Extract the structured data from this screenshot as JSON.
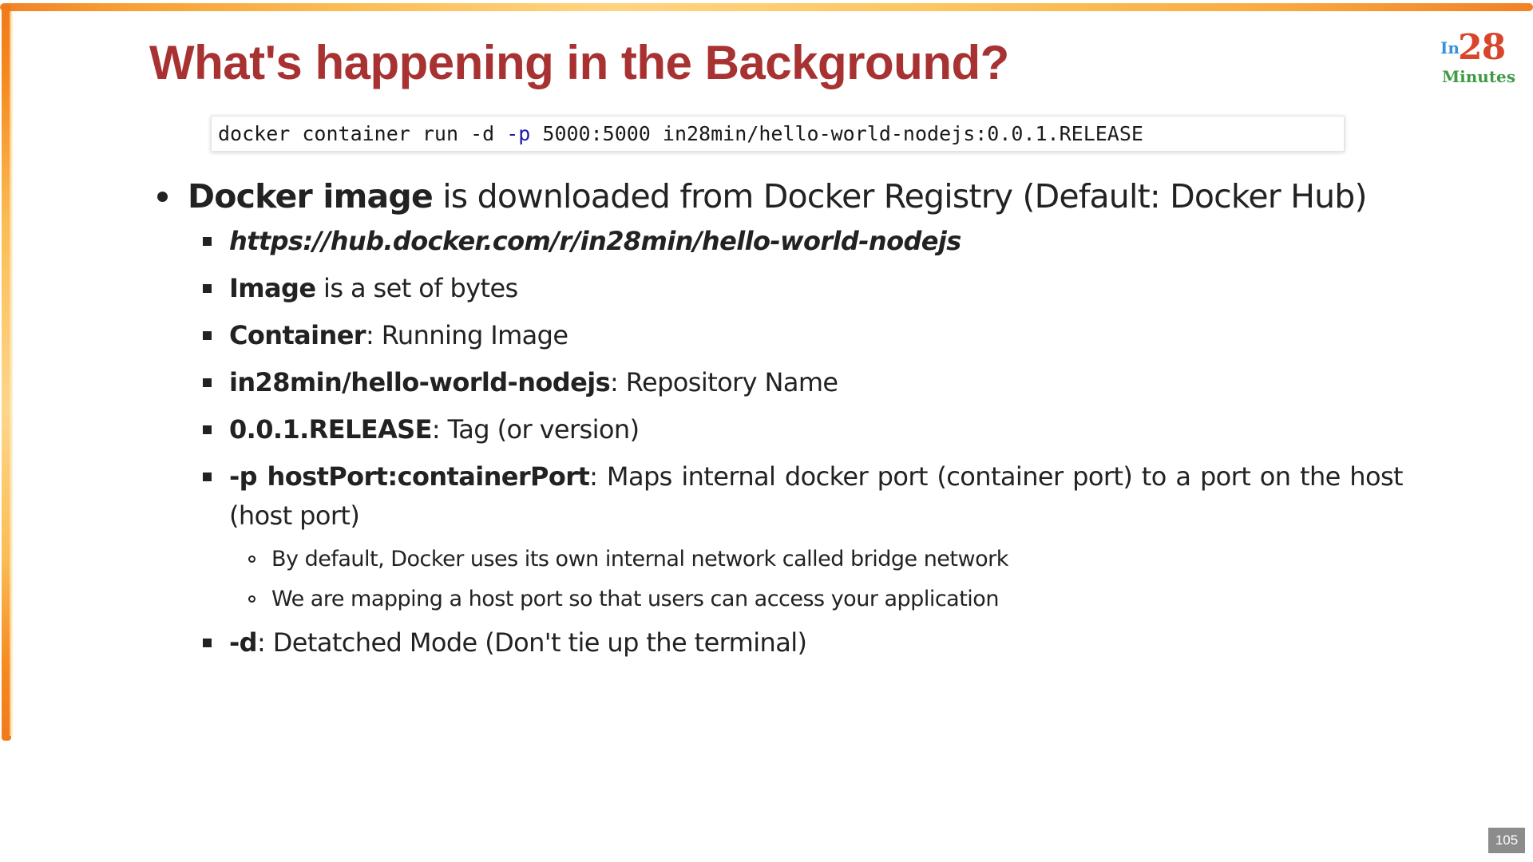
{
  "slide": {
    "title": "What's happening in the Background?",
    "page_number": "105"
  },
  "logo": {
    "prefix": "In",
    "number": "28",
    "suffix": "Minutes"
  },
  "code": {
    "before_flag": "docker container run -d ",
    "flag": "-p",
    "after_flag": " 5000:5000 in28min/hello-world-nodejs:0.0.1.RELEASE"
  },
  "bullets": {
    "main": {
      "bold": "Docker image",
      "text": " is downloaded from Docker Registry (Default: Docker Hub)"
    },
    "url": "https://hub.docker.com/r/in28min/hello-world-nodejs",
    "image": {
      "bold": "Image",
      "text": " is a set of bytes"
    },
    "container": {
      "bold": "Container",
      "text": ": Running Image"
    },
    "repository": {
      "bold": "in28min/hello-world-nodejs",
      "text": ": Repository Name"
    },
    "tag": {
      "bold": "0.0.1.RELEASE",
      "text": ": Tag (or version)"
    },
    "port": {
      "bold": "-p hostPort:containerPort",
      "text": ": Maps internal docker port (container port) to a port on the host (host port)"
    },
    "port_sub": [
      "By default, Docker uses its own internal network called bridge network",
      "We are mapping a host port so that users can access your application"
    ],
    "detached": {
      "bold": "-d",
      "text": ": Detatched Mode (Don't tie up the terminal)"
    }
  },
  "colors": {
    "title": "#a83232",
    "code_flag": "#1a1aa6",
    "border_orange": "#f07a1a",
    "border_yellow": "#fbbd55",
    "page_badge": "#8c8c8c"
  }
}
